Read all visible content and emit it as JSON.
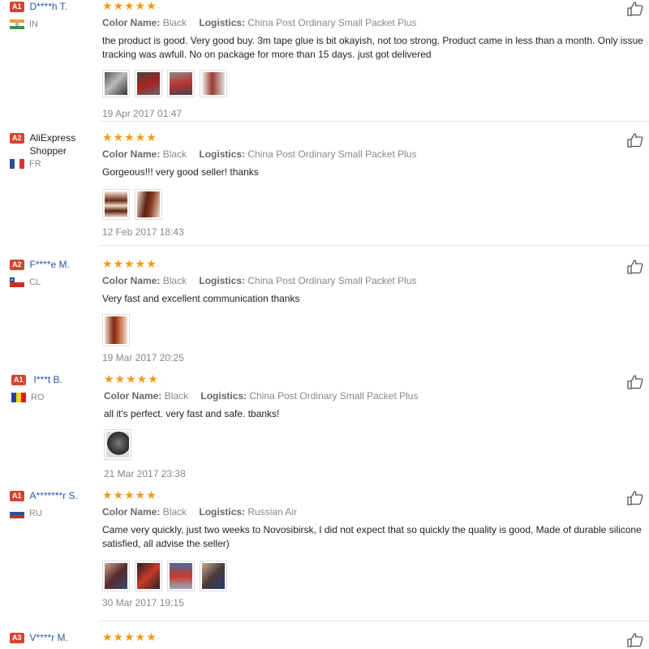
{
  "labels": {
    "color_name": "Color Name:",
    "logistics": "Logistics:"
  },
  "colors": {
    "accent_link": "#2a55a8",
    "badge_bg": "#d9432f",
    "stars": "#f39a10"
  },
  "reviews": [
    {
      "badge": "A1",
      "name": "D****h T.",
      "country": "IN",
      "flag": "india-flag-icon",
      "color_value": "Black",
      "logistics_value": "China Post Ordinary Small Packet Plus",
      "text": "the product is good. Very good buy. 3m tape glue is bit okayish, not too strong. Product came in less than a month. Only issue tracking was awfull. No on package for more than 15 days. just got delivered",
      "photo_count": 4,
      "date": "19 Apr 2017 01:47",
      "rating": 5
    },
    {
      "badge": "A2",
      "name": "AliExpress Shopper",
      "country": "FR",
      "flag": "france-flag-icon",
      "color_value": "Black",
      "logistics_value": "China Post Ordinary Small Packet Plus",
      "text": "Gorgeous!!! very good seller! thanks",
      "photo_count": 2,
      "date": "12 Feb 2017 18:43",
      "rating": 5
    },
    {
      "badge": "A2",
      "name": "F****e M.",
      "country": "CL",
      "flag": "chile-flag-icon",
      "color_value": "Black",
      "logistics_value": "China Post Ordinary Small Packet Plus",
      "text": "Very fast and excellent communication thanks",
      "photo_count": 1,
      "date": "19 Mar 2017 20:25",
      "rating": 5
    },
    {
      "badge": "A1",
      "name": "I***t B.",
      "country": "RO",
      "flag": "romania-flag-icon",
      "color_value": "Black",
      "logistics_value": "China Post Ordinary Small Packet Plus",
      "text": "all it's perfect. very fast and safe. tbanks!",
      "photo_count": 1,
      "date": "21 Mar 2017 23:38",
      "rating": 5
    },
    {
      "badge": "A1",
      "name": "A*******r S.",
      "country": "RU",
      "flag": "russia-flag-icon",
      "color_value": "Black",
      "logistics_value": "Russian Air",
      "text": "Came very quickly, just two weeks to Novosibirsk, I did not expect that so quickly the quality is good, Made of durable silicone satisfied, all advise the seller)",
      "photo_count": 4,
      "date": "30 Mar 2017 19:15",
      "rating": 5
    },
    {
      "badge": "A3",
      "name": "V****r M.",
      "rating": 5
    }
  ]
}
